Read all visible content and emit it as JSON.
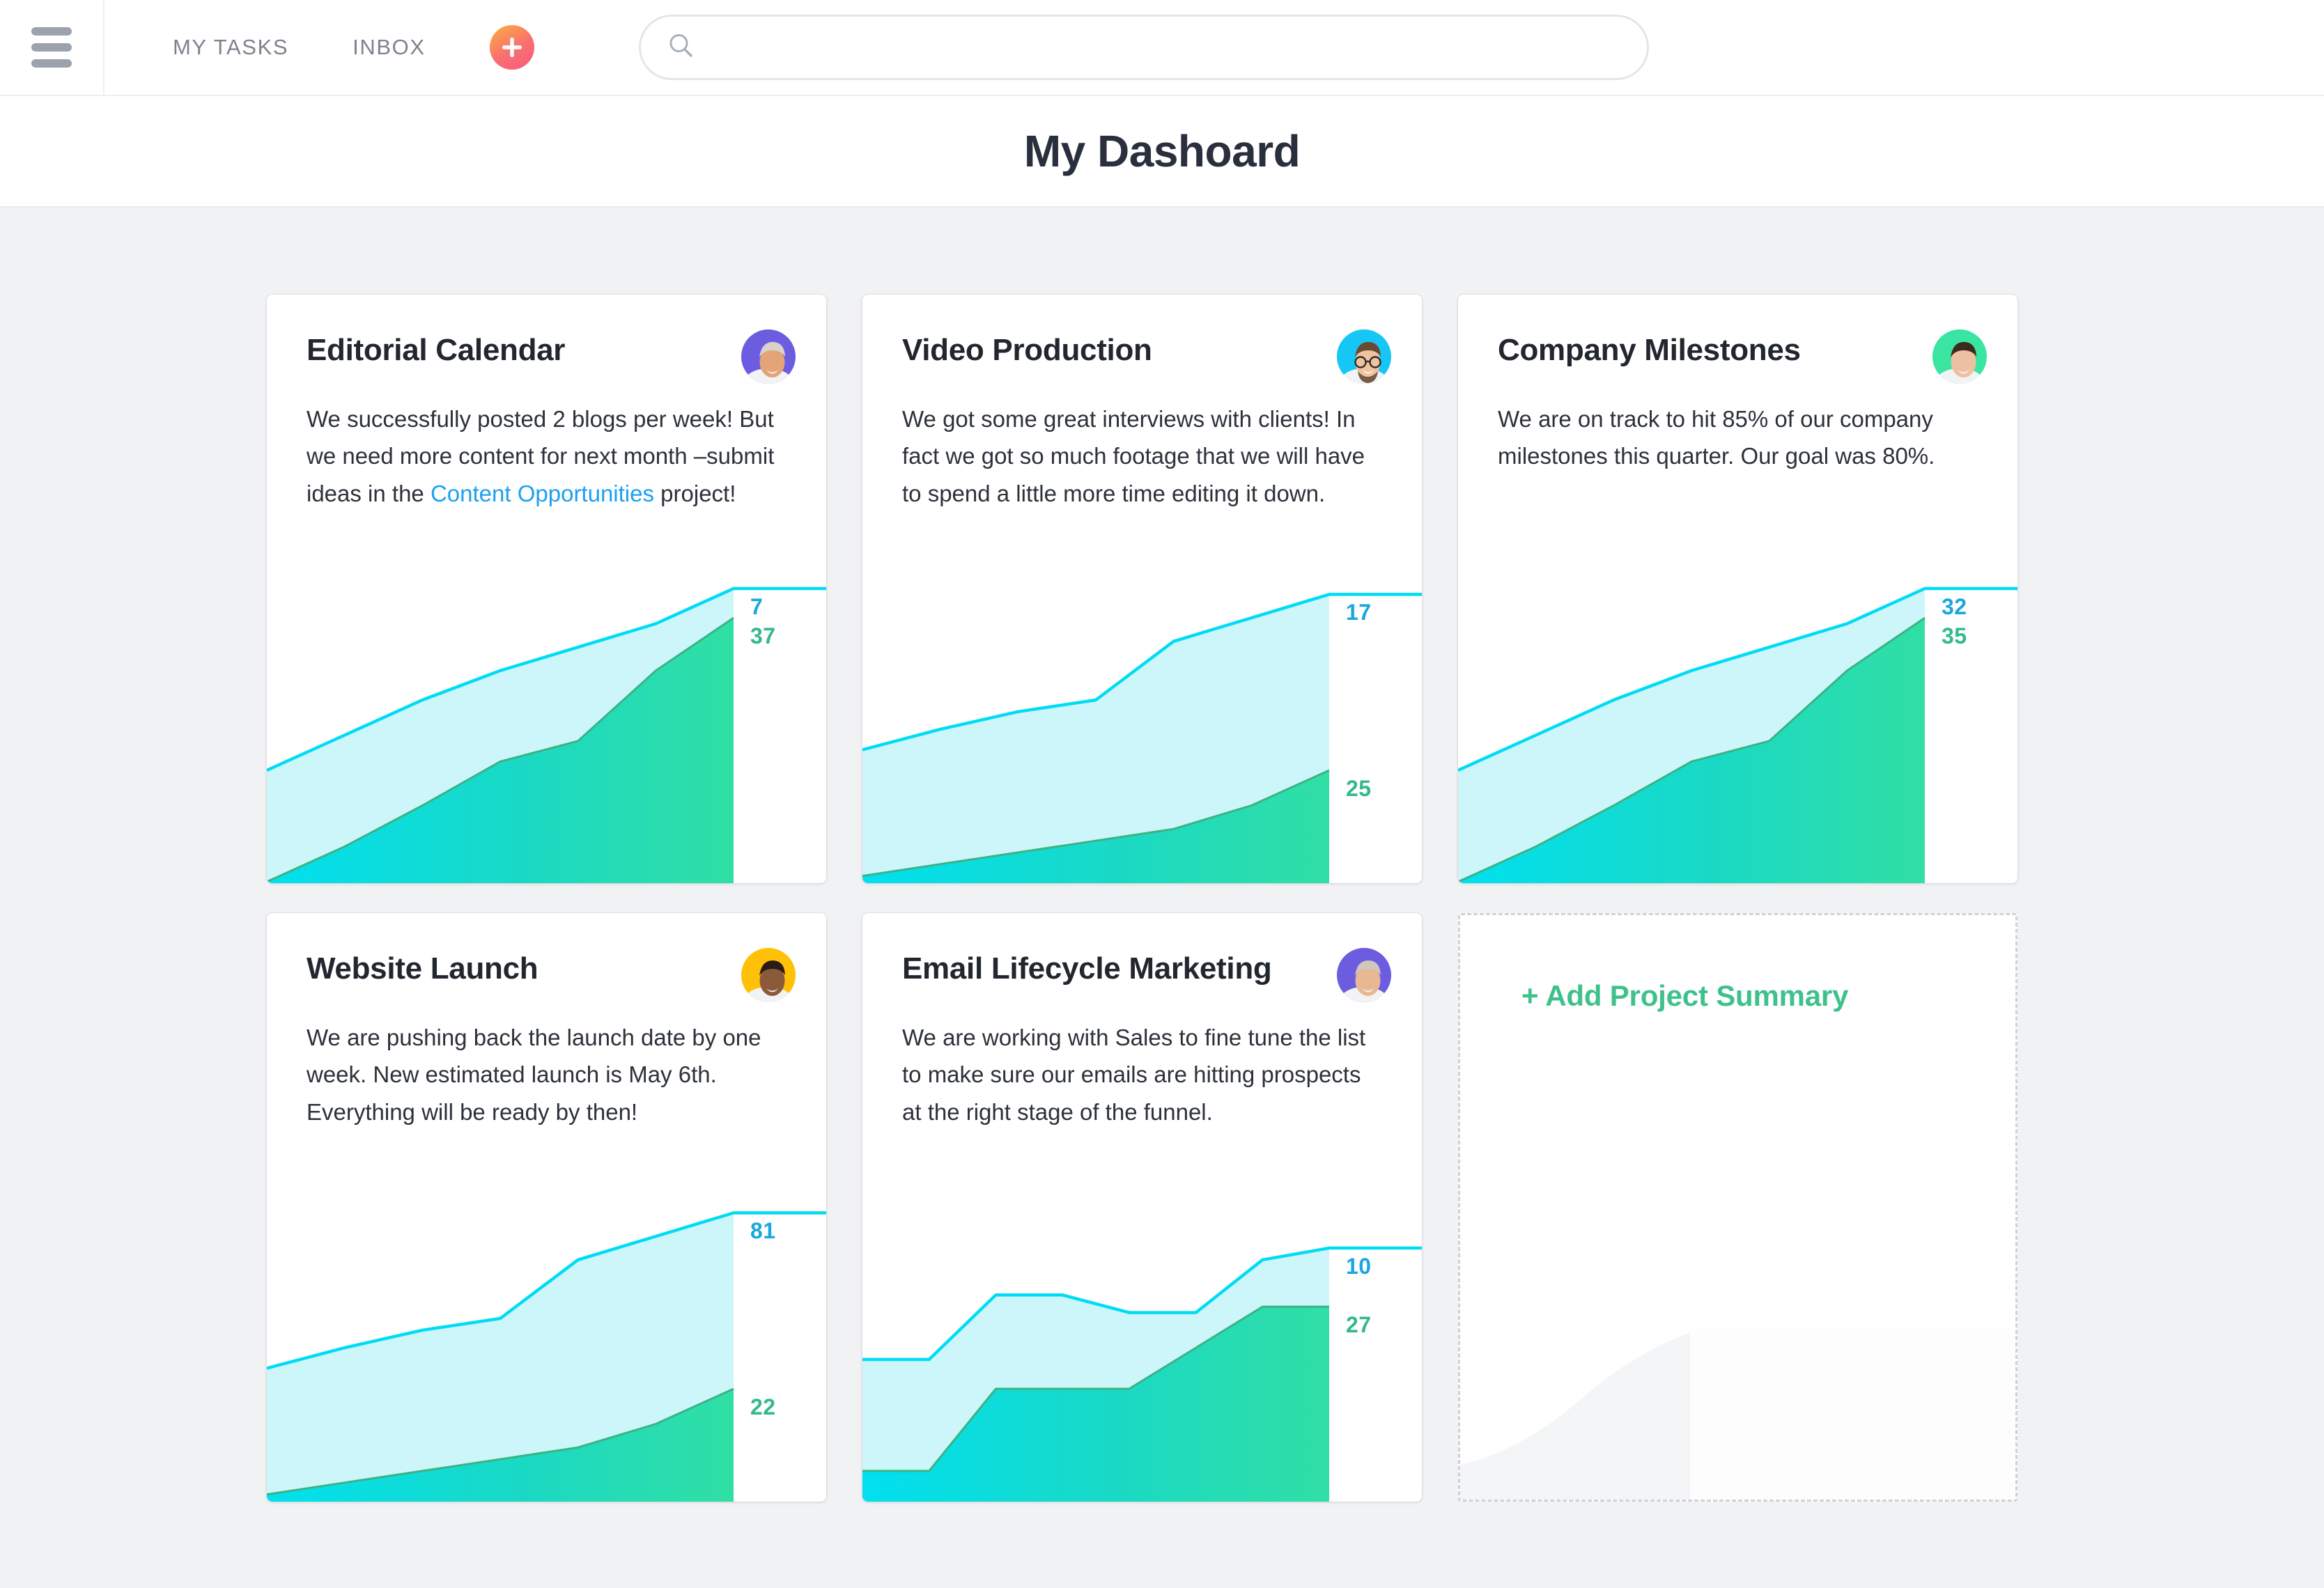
{
  "topnav": {
    "menu_icon": "hamburger-icon",
    "links": [
      {
        "label": "MY TASKS"
      },
      {
        "label": "INBOX"
      }
    ],
    "add_button_icon": "plus-icon",
    "search": {
      "icon": "search-icon",
      "value": "",
      "placeholder": ""
    }
  },
  "header": {
    "title": "My Dashoard"
  },
  "cards": [
    {
      "title": "Editorial Calendar",
      "avatar_color": "#6c5ce0",
      "avatar_name": "avatar-editorial-calendar",
      "body_parts": [
        {
          "type": "text",
          "text": "We successfully posted 2 blogs per week! But we need more content for next month –submit ideas in the "
        },
        {
          "type": "link",
          "text": "Content Opportunities"
        },
        {
          "type": "text",
          "text": " project!"
        }
      ],
      "chart": {
        "top_label": "7",
        "bottom_label": "37",
        "top_label_color": "#1ba7dd",
        "bottom_label_color": "#34b98a"
      }
    },
    {
      "title": "Video Production",
      "avatar_color": "#16c6f5",
      "avatar_name": "avatar-video-production",
      "body_parts": [
        {
          "type": "text",
          "text": "We got some great interviews with clients! In fact we got so much footage that we will have to spend a little more time editing it down."
        }
      ],
      "chart": {
        "top_label": "17",
        "bottom_label": "25",
        "top_label_color": "#1ba7dd",
        "bottom_label_color": "#34b98a"
      }
    },
    {
      "title": "Company Milestones",
      "avatar_color": "#3ae5a2",
      "avatar_name": "avatar-company-milestones",
      "body_parts": [
        {
          "type": "text",
          "text": "We are on track to hit 85% of our company milestones this quarter. Our goal was 80%."
        }
      ],
      "chart": {
        "top_label": "32",
        "bottom_label": "35",
        "top_label_color": "#1ba7dd",
        "bottom_label_color": "#34b98a"
      }
    },
    {
      "title": "Website Launch",
      "avatar_color": "#ffc107",
      "avatar_name": "avatar-website-launch",
      "body_parts": [
        {
          "type": "text",
          "text": "We are pushing back the launch date by one week. New estimated launch is May 6th. Everything will be ready by then!"
        }
      ],
      "chart": {
        "top_label": "81",
        "bottom_label": "22",
        "top_label_color": "#1ba7dd",
        "bottom_label_color": "#34b98a"
      }
    },
    {
      "title": "Email Lifecycle Marketing",
      "avatar_color": "#6c5ce0",
      "avatar_name": "avatar-email-lifecycle-marketing",
      "body_parts": [
        {
          "type": "text",
          "text": "We are working with Sales to fine tune the list to make sure our emails are hitting prospects at the right stage of the funnel."
        }
      ],
      "chart": {
        "top_label": "10",
        "bottom_label": "27",
        "top_label_color": "#1ba7dd",
        "bottom_label_color": "#34b98a"
      }
    }
  ],
  "add_card": {
    "label": "+ Add Project Summary"
  },
  "chart_data": [
    {
      "type": "area",
      "title": "Editorial Calendar",
      "x": [
        0,
        1,
        2,
        3,
        4,
        5,
        6
      ],
      "series": [
        {
          "name": "upper",
          "values": [
            38,
            50,
            62,
            72,
            80,
            88,
            100
          ],
          "color": "#00dcf5",
          "fill": "#cdf6fb"
        },
        {
          "name": "lower",
          "values": [
            0,
            12,
            26,
            41,
            48,
            72,
            90
          ],
          "color": "#2fd6a8",
          "fill": "#2ee6b6"
        }
      ],
      "end_labels": {
        "upper": "7",
        "lower": "37"
      },
      "grid": false,
      "legend": "none",
      "xlabel": "",
      "ylabel": ""
    },
    {
      "type": "area",
      "title": "Video Production",
      "x": [
        0,
        1,
        2,
        3,
        4,
        5,
        6
      ],
      "series": [
        {
          "name": "upper",
          "values": [
            45,
            52,
            58,
            62,
            82,
            90,
            98
          ],
          "color": "#00dcf5",
          "fill": "#cdf6fb"
        },
        {
          "name": "lower",
          "values": [
            2,
            6,
            10,
            14,
            18,
            26,
            38
          ],
          "color": "#2fd6a8",
          "fill": "#2ee6b6"
        }
      ],
      "end_labels": {
        "upper": "17",
        "lower": "25"
      },
      "grid": false,
      "legend": "none",
      "xlabel": "",
      "ylabel": ""
    },
    {
      "type": "area",
      "title": "Company Milestones",
      "x": [
        0,
        1,
        2,
        3,
        4,
        5,
        6
      ],
      "series": [
        {
          "name": "upper",
          "values": [
            38,
            50,
            62,
            72,
            80,
            88,
            100
          ],
          "color": "#00dcf5",
          "fill": "#cdf6fb"
        },
        {
          "name": "lower",
          "values": [
            0,
            12,
            26,
            41,
            48,
            72,
            90
          ],
          "color": "#2fd6a8",
          "fill": "#2ee6b6"
        }
      ],
      "end_labels": {
        "upper": "32",
        "lower": "35"
      },
      "grid": false,
      "legend": "none",
      "xlabel": "",
      "ylabel": ""
    },
    {
      "type": "area",
      "title": "Website Launch",
      "x": [
        0,
        1,
        2,
        3,
        4,
        5,
        6
      ],
      "series": [
        {
          "name": "upper",
          "values": [
            45,
            52,
            58,
            62,
            82,
            90,
            98
          ],
          "color": "#00dcf5",
          "fill": "#cdf6fb"
        },
        {
          "name": "lower",
          "values": [
            2,
            6,
            10,
            14,
            18,
            26,
            38
          ],
          "color": "#2fd6a8",
          "fill": "#2ee6b6"
        }
      ],
      "end_labels": {
        "upper": "81",
        "lower": "22"
      },
      "grid": false,
      "legend": "none",
      "xlabel": "",
      "ylabel": ""
    },
    {
      "type": "area",
      "title": "Email Lifecycle Marketing",
      "x": [
        0,
        1,
        2,
        3,
        4,
        5,
        6,
        7
      ],
      "series": [
        {
          "name": "upper",
          "values": [
            48,
            48,
            70,
            70,
            64,
            64,
            82,
            86
          ],
          "color": "#00dcf5",
          "fill": "#cdf6fb"
        },
        {
          "name": "lower",
          "values": [
            10,
            10,
            38,
            38,
            38,
            52,
            66,
            66
          ],
          "color": "#2fd6a8",
          "fill": "#2ee6b6"
        }
      ],
      "end_labels": {
        "upper": "10",
        "lower": "27"
      },
      "grid": false,
      "legend": "none",
      "xlabel": "",
      "ylabel": ""
    }
  ]
}
